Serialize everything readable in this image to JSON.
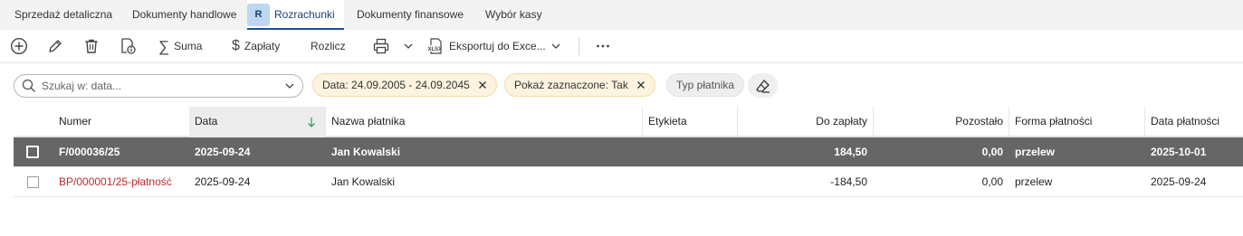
{
  "tabs": [
    {
      "label": "Sprzedaż detaliczna"
    },
    {
      "label": "Dokumenty handlowe"
    },
    {
      "label": "Rozrachunki",
      "badge": "R",
      "active": true
    },
    {
      "label": "Dokumenty finansowe"
    },
    {
      "label": "Wybór kasy"
    }
  ],
  "toolbar": {
    "add_icon": "plus-circle-icon",
    "edit_icon": "pencil-icon",
    "delete_icon": "trash-icon",
    "preview_icon": "document-info-icon",
    "sum_label": "Suma",
    "payments_label": "Zapłaty",
    "settle_label": "Rozlicz",
    "print_icon": "printer-icon",
    "export_label": "Eksportuj do Exce...",
    "more_icon": "more-horizontal-icon"
  },
  "filters": {
    "search_placeholder": "Szukaj w: data...",
    "chip_date": "Data: 24.09.2005 - 24.09.2045",
    "chip_selected": "Pokaż zaznaczone: Tak",
    "chip_payer_type": "Typ płatnika",
    "clear_icon": "eraser-icon"
  },
  "table": {
    "columns": {
      "number": "Numer",
      "date": "Data",
      "payer": "Nazwa płatnika",
      "tag": "Etykieta",
      "to_pay": "Do zapłaty",
      "remaining": "Pozostało",
      "payment_form": "Forma płatności",
      "payment_date": "Data płatności"
    },
    "sort": {
      "column": "Data",
      "direction": "descending"
    },
    "rows": [
      {
        "number": "F/000036/25",
        "date": "2025-09-24",
        "payer": "Jan Kowalski",
        "tag": "",
        "to_pay": "184,50",
        "remaining": "0,00",
        "payment_form": "przelew",
        "payment_date": "2025-10-01",
        "selected": true
      },
      {
        "number": "BP/000001/25-płatność",
        "date": "2025-09-24",
        "payer": "Jan Kowalski",
        "tag": "",
        "to_pay": "-184,50",
        "remaining": "0,00",
        "payment_form": "przelew",
        "payment_date": "2025-09-24",
        "selected": false
      }
    ]
  },
  "colors": {
    "active_tab_text": "#1a3d7a",
    "tab_badge_bg": "#bcd7f2",
    "selected_row_bg": "#666666",
    "negative_number_text": "#c0282c",
    "active_chip_bg": "#fdf3de",
    "sort_arrow": "#3aa757"
  }
}
